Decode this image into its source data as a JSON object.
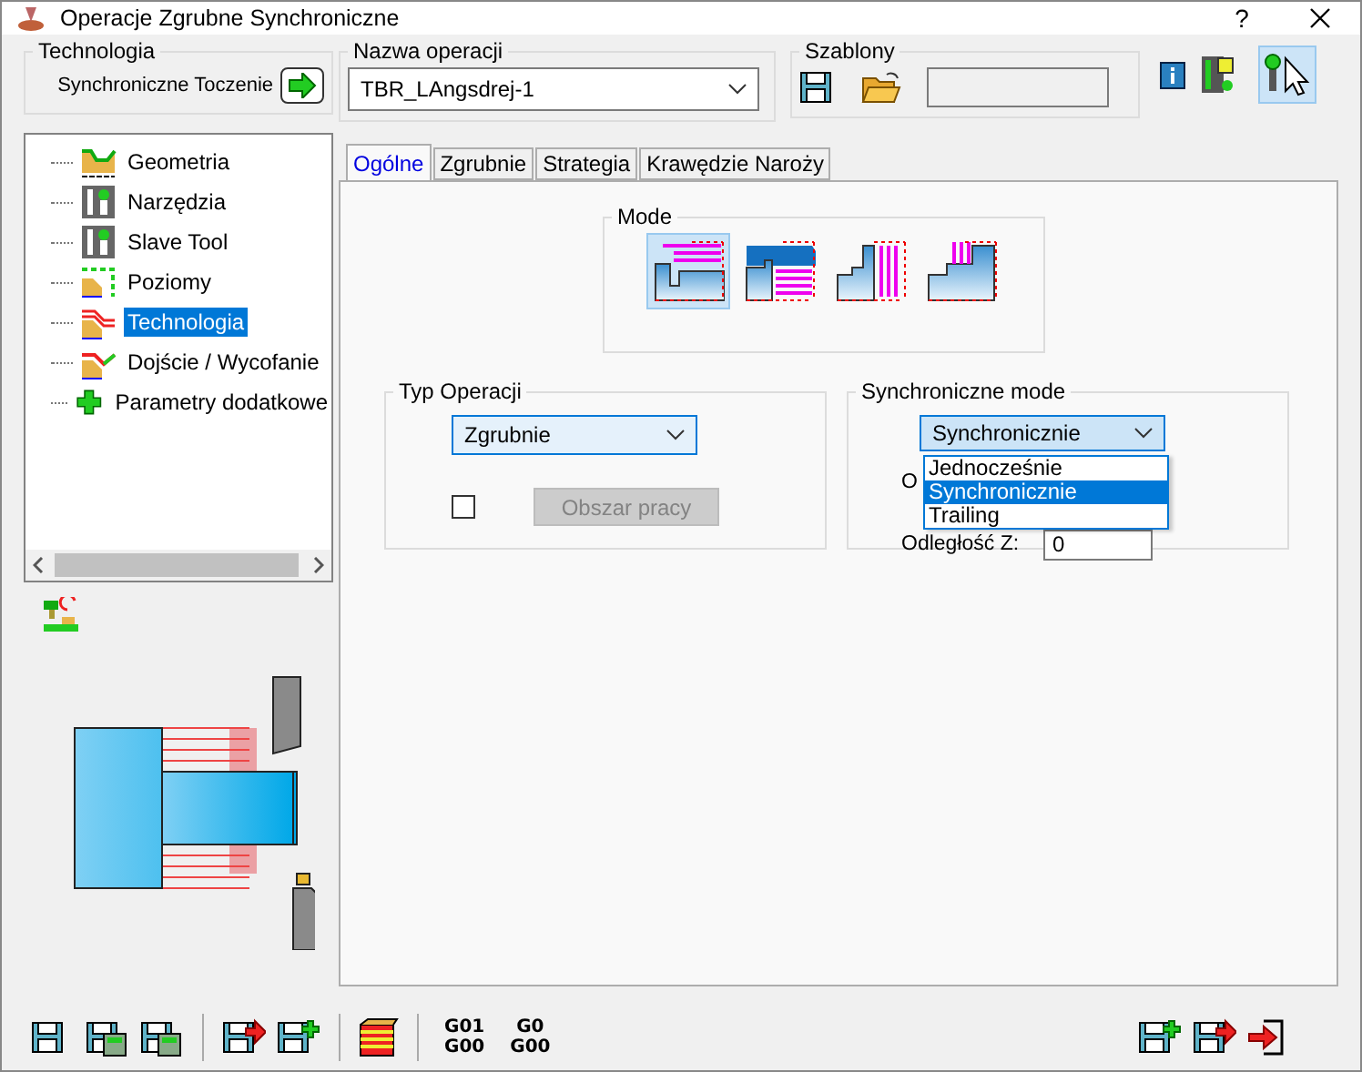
{
  "window": {
    "title": "Operacje Zgrubne Synchroniczne",
    "help": "?"
  },
  "technologia": {
    "label": "Technologia",
    "value": "Synchroniczne Toczenie"
  },
  "nazwa_operacji": {
    "label": "Nazwa operacji",
    "value": "TBR_LAngsdrej-1"
  },
  "szablony": {
    "label": "Szablony"
  },
  "tree": {
    "items": [
      {
        "label": "Geometria",
        "kind": "geometry",
        "selected": false
      },
      {
        "label": "Narzędzia",
        "kind": "tool",
        "selected": false
      },
      {
        "label": "Slave Tool",
        "kind": "tool",
        "selected": false
      },
      {
        "label": "Poziomy",
        "kind": "levels",
        "selected": false
      },
      {
        "label": "Technologia",
        "kind": "technology",
        "selected": true
      },
      {
        "label": "Dojście / Wycofanie",
        "kind": "approach",
        "selected": false
      },
      {
        "label": "Parametry dodatkowe",
        "kind": "extra",
        "selected": false
      }
    ]
  },
  "tabs": [
    {
      "label": "Ogólne",
      "selected": true
    },
    {
      "label": "Zgrubnie",
      "selected": false
    },
    {
      "label": "Strategia",
      "selected": false
    },
    {
      "label": "Krawędzie Naroży",
      "selected": false
    }
  ],
  "mode": {
    "label": "Mode",
    "options": [
      {
        "kind": "longitudinal",
        "selected": true
      },
      {
        "kind": "contour",
        "selected": false
      },
      {
        "kind": "face",
        "selected": false
      },
      {
        "kind": "plunge",
        "selected": false
      }
    ]
  },
  "typ_operacji": {
    "label": "Typ Operacji",
    "value": "Zgrubnie",
    "checked": false,
    "button": {
      "label": "Obszar pracy",
      "disabled": true
    }
  },
  "synchroniczne_mode": {
    "label": "Synchroniczne mode",
    "value": "Synchronicznie",
    "expanded": true,
    "options": [
      {
        "label": "Jednocześnie",
        "selected": false
      },
      {
        "label": "Synchronicznie",
        "selected": true
      },
      {
        "label": "Trailing",
        "selected": false
      }
    ],
    "fields": [
      {
        "label": "O"
      },
      {
        "label": "Odległość Z:",
        "value": "0"
      }
    ]
  },
  "gcode_buttons": [
    {
      "top": "G01",
      "bottom": "G00"
    },
    {
      "top": "G0",
      "bottom": "G00"
    }
  ]
}
